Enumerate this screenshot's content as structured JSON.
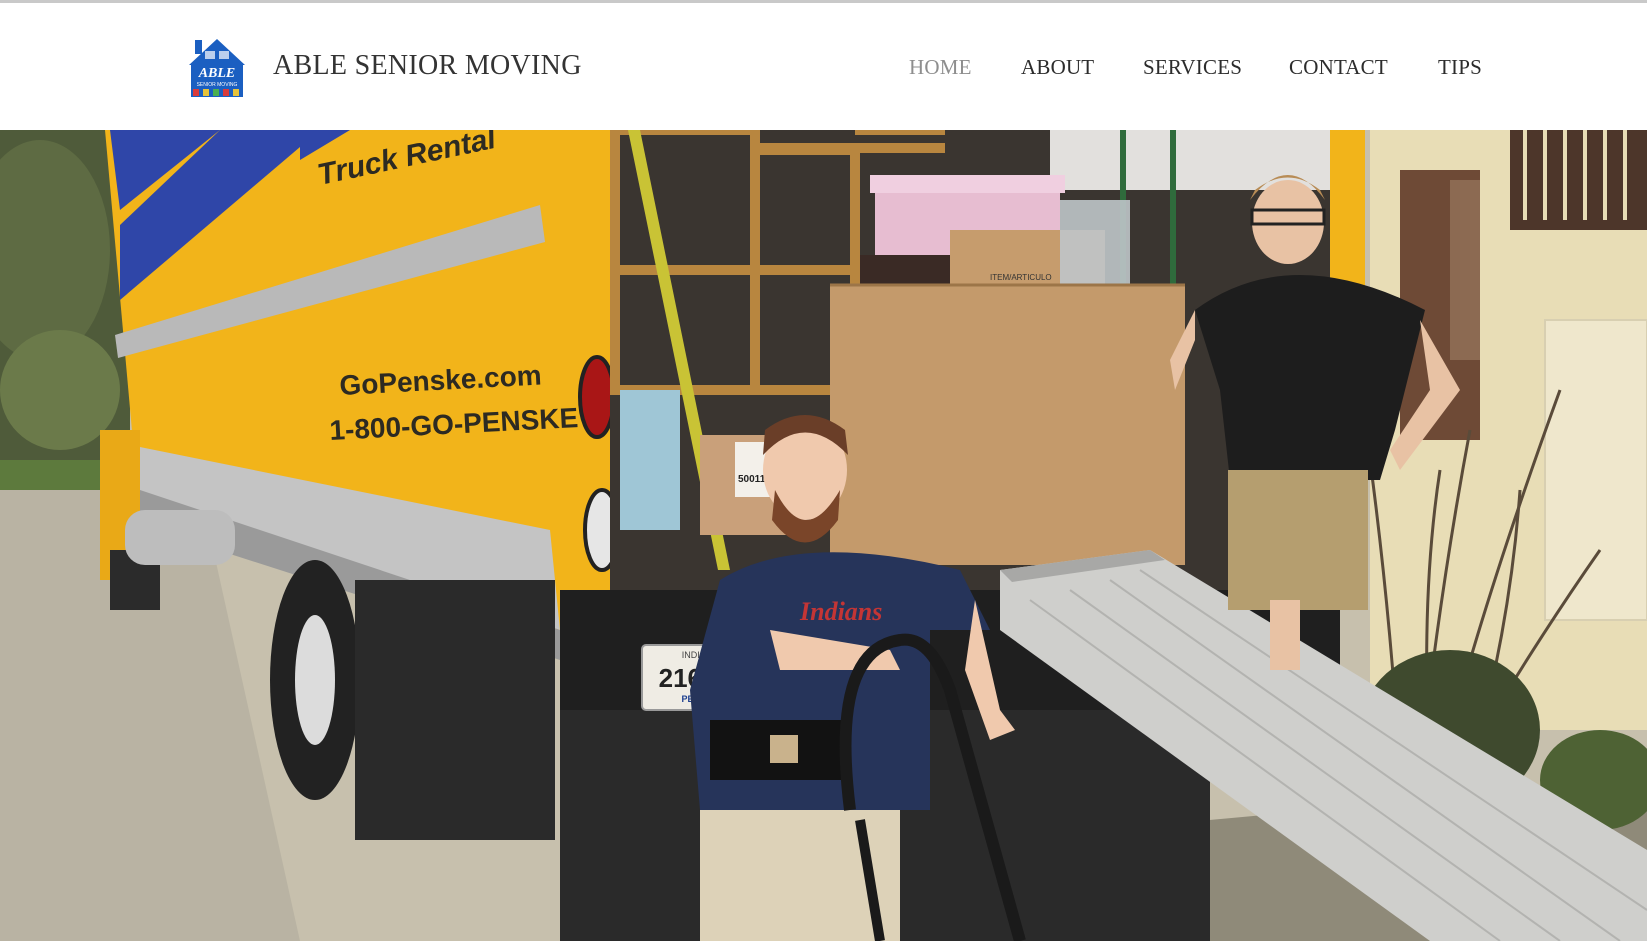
{
  "site": {
    "title": "ABLE SENIOR MOVING",
    "logo": {
      "word": "ABLE",
      "sub": "SENIOR MOVING",
      "icon": "house-logo-icon",
      "color": "#1b5fc1"
    }
  },
  "nav": {
    "items": [
      {
        "label": "HOME",
        "active": true
      },
      {
        "label": "ABOUT",
        "active": false
      },
      {
        "label": "SERVICES",
        "active": false
      },
      {
        "label": "CONTACT",
        "active": false
      },
      {
        "label": "TIPS",
        "active": false
      }
    ],
    "active_color": "#8e8e8e",
    "text_color": "#2c2c2c"
  },
  "hero": {
    "truck": {
      "brand_line": "Truck Rental",
      "website": "GoPenske.com",
      "phone": "1-800-GO-PENSKE",
      "plate_number": "216214",
      "plate_state": "INDIANA",
      "plate_brand": "PENSKE",
      "box_label": "ITEM/ARTICULO",
      "box_code": "500117",
      "color": "#f2b41a"
    },
    "shirt_text": "Indians"
  }
}
